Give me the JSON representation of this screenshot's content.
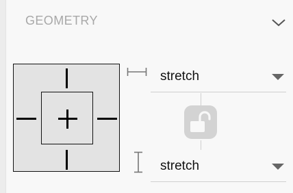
{
  "geometry": {
    "title": "GEOMETRY",
    "collapse_icon": "chevron-down-icon",
    "width": {
      "icon": "width-bracket-icon",
      "value": "stretch"
    },
    "height": {
      "icon": "height-bracket-icon",
      "value": "stretch"
    },
    "lock": {
      "icon": "unlocked-padlock-icon",
      "state": "unlocked"
    },
    "colors": {
      "title": "#a8a8a8",
      "anchor_fill": "#e3e3e3",
      "lock_fill": "#d3d3d3"
    }
  }
}
